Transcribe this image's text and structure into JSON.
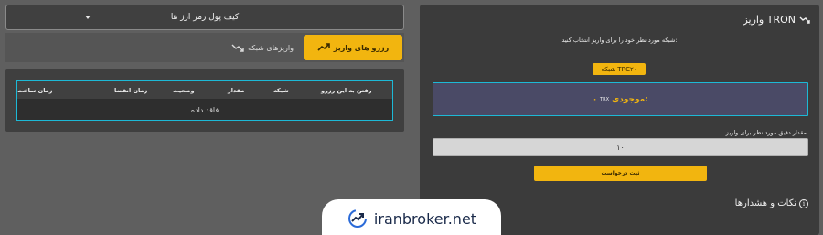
{
  "wallet_select": {
    "label": "کیف پول رمز ارز ها"
  },
  "tabs": [
    {
      "label": "واریزهای شبکه",
      "icon": "trend-down-icon",
      "active": false
    },
    {
      "label": "رزرو های واریز",
      "icon": "trend-up-icon",
      "active": true
    }
  ],
  "history_table": {
    "columns": [
      "رفتن به این رزرو",
      "شبکه",
      "مقدار",
      "وضعیت",
      "زمان انقضا",
      "زمان ساخت"
    ],
    "empty_text": "فاقد داده"
  },
  "deposit": {
    "title": "واریز TRON",
    "title_icon": "trend-down-icon",
    "network_prompt": "شبکه مورد نظر خود را برای واریز انتخاب کنید:",
    "network_badge": "شبکه TRC۲۰",
    "balance_label": "موجودی:",
    "balance_unit": "TRX",
    "balance_value": "۰",
    "amount_label": "مقدار دقیق مورد نظر برای واریز",
    "amount_value": "۱۰",
    "submit_label": "ثبت درخواست",
    "notes_label": "نکات و هشدارها",
    "notes_icon": "info-icon"
  },
  "watermark": {
    "text": "iranbroker.net",
    "icon": "chart-logo-icon"
  },
  "colors": {
    "accent": "#f2b50f",
    "border_accent": "#1db9d6",
    "panel": "#3b3b3b"
  }
}
